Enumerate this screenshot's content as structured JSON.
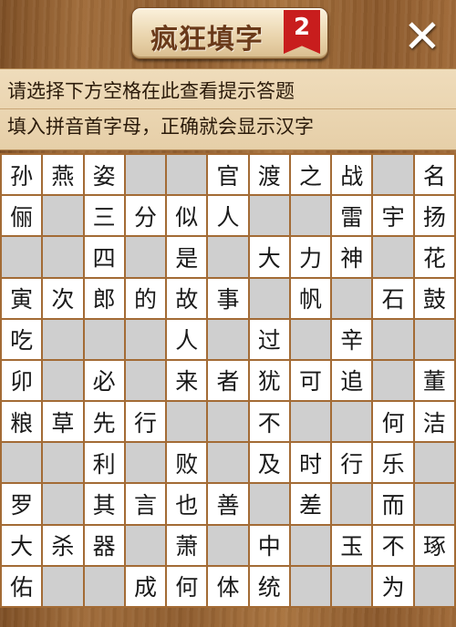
{
  "header": {
    "title": "疯狂填字",
    "level": "2",
    "close_label": "✕"
  },
  "hints": {
    "line1": "请选择下方空格在此查看提示答题",
    "line2": "填入拼音首字母，正确就会显示汉字"
  },
  "colors": {
    "wood": "#8f5d2f",
    "badge": "#c81d1d",
    "blocked_cell": "#cfcfcf",
    "open_cell": "#ffffff",
    "grid_line": "#a36b35"
  },
  "grid": {
    "rows": [
      [
        "孙",
        "燕",
        "姿",
        "#",
        "#",
        "官",
        "渡",
        "之",
        "战",
        "#",
        "名"
      ],
      [
        "俪",
        "#",
        "三",
        "分",
        "似",
        "人",
        "#",
        "#",
        "雷",
        "宇",
        "扬"
      ],
      [
        "#",
        "#",
        "四",
        "#",
        "是",
        "#",
        "大",
        "力",
        "神",
        "#",
        "花"
      ],
      [
        "寅",
        "次",
        "郎",
        "的",
        "故",
        "事",
        "#",
        "帆",
        "#",
        "石",
        "鼓"
      ],
      [
        "吃",
        "#",
        "#",
        "#",
        "人",
        "#",
        "过",
        "#",
        "辛",
        "#",
        "#"
      ],
      [
        "卯",
        "#",
        "必",
        "#",
        "来",
        "者",
        "犹",
        "可",
        "追",
        "#",
        "董"
      ],
      [
        "粮",
        "草",
        "先",
        "行",
        "#",
        "#",
        "不",
        "#",
        "#",
        "何",
        "洁"
      ],
      [
        "#",
        "#",
        "利",
        "#",
        "败",
        "#",
        "及",
        "时",
        "行",
        "乐",
        "#"
      ],
      [
        "罗",
        "#",
        "其",
        "言",
        "也",
        "善",
        "#",
        "差",
        "#",
        "而",
        "#"
      ],
      [
        "大",
        "杀",
        "器",
        "#",
        "萧",
        "#",
        "中",
        "#",
        "玉",
        "不",
        "琢"
      ],
      [
        "佑",
        "#",
        "#",
        "成",
        "何",
        "体",
        "统",
        "#",
        "#",
        "为",
        "#"
      ]
    ]
  }
}
